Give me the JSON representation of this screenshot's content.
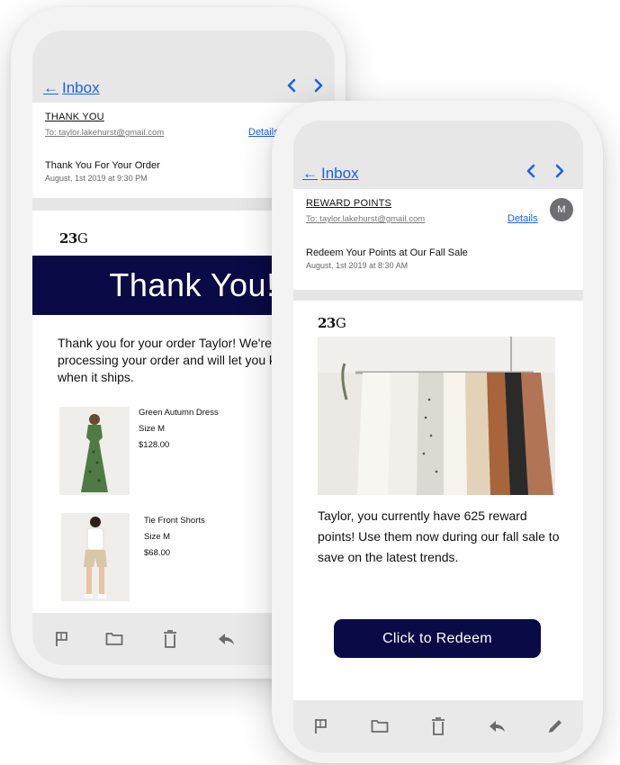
{
  "back_phone": {
    "nav": {
      "back_label": "Inbox",
      "back_arrow": "←",
      "prev": "‹",
      "next": "›"
    },
    "email": {
      "subject": "THANK YOU",
      "to": "To: taylor.lakehurst@gmail.com",
      "details_label": "Details",
      "title": "Thank You For Your Order",
      "date": "August, 1st 2019 at 9:30 PM"
    },
    "logo": {
      "num": "23",
      "glyph": "G"
    },
    "banner_text": "Thank You!",
    "message": "Thank you for your order Taylor! We're processing your order and will let you know when it ships.",
    "products": [
      {
        "name": "Green Autumn Dress",
        "size": "Size M",
        "price": "$128.00"
      },
      {
        "name": "Tie Front Shorts",
        "size": "Size M",
        "price": "$68.00"
      }
    ],
    "toolbar": [
      "flag-icon",
      "folder-icon",
      "trash-icon",
      "reply-icon"
    ]
  },
  "front_phone": {
    "nav": {
      "back_label": "Inbox",
      "back_arrow": "←",
      "prev": "‹",
      "next": "›"
    },
    "email": {
      "subject": "REWARD POINTS",
      "to": "To: taylor.lakehurst@gmail.com",
      "details_label": "Details",
      "avatar": "M",
      "title": "Redeem Your Points at Our Fall Sale",
      "date": "August, 1st 2019 at 8:30 AM"
    },
    "logo": {
      "num": "23",
      "glyph": "G"
    },
    "message": "Taylor, you currently have 625 reward points! Use them now during our fall sale to save on the latest trends.",
    "cta_label": "Click to Redeem",
    "toolbar": [
      "flag-icon",
      "folder-icon",
      "trash-icon",
      "reply-icon",
      "compose-icon"
    ]
  },
  "colors": {
    "accent": "#1b62e6",
    "navy": "#0a0a46"
  }
}
